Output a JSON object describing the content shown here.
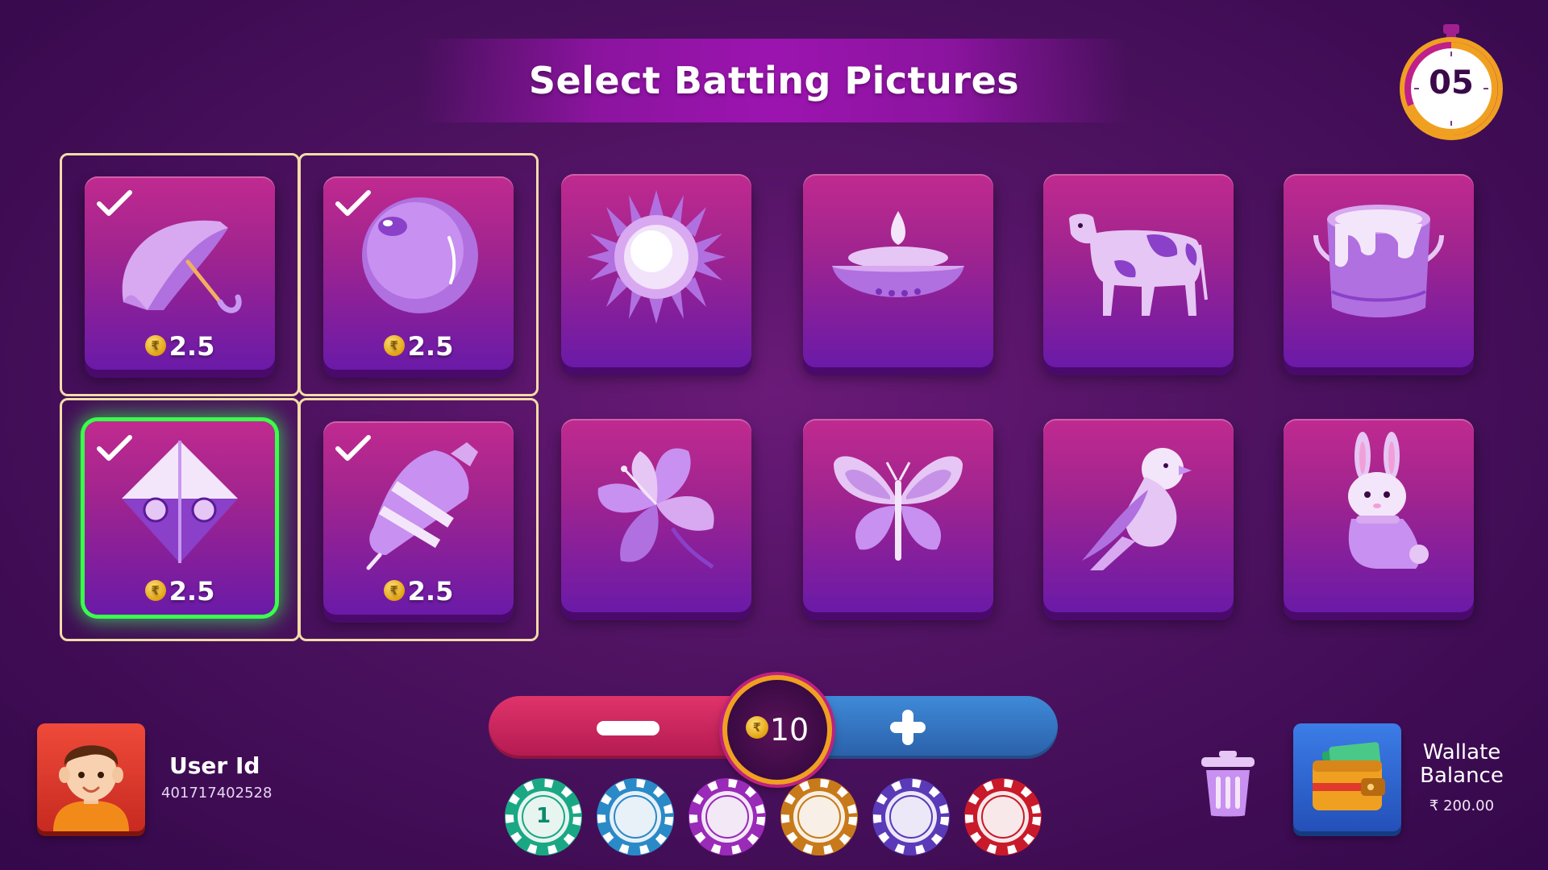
{
  "header": {
    "title": "Select Batting Pictures"
  },
  "timer": {
    "seconds": "05"
  },
  "tiles": [
    {
      "name": "umbrella",
      "selected": true,
      "amount": "2.5"
    },
    {
      "name": "ball",
      "selected": true,
      "amount": "2.5"
    },
    {
      "name": "sun",
      "selected": false,
      "amount": ""
    },
    {
      "name": "diya",
      "selected": false,
      "amount": ""
    },
    {
      "name": "cow",
      "selected": false,
      "amount": ""
    },
    {
      "name": "bucket",
      "selected": false,
      "amount": ""
    },
    {
      "name": "kite",
      "selected": true,
      "highlighted": true,
      "amount": "2.5"
    },
    {
      "name": "spinning-top",
      "selected": true,
      "amount": "2.5"
    },
    {
      "name": "flower",
      "selected": false,
      "amount": ""
    },
    {
      "name": "butterfly",
      "selected": false,
      "amount": ""
    },
    {
      "name": "bird",
      "selected": false,
      "amount": ""
    },
    {
      "name": "rabbit",
      "selected": false,
      "amount": ""
    }
  ],
  "currency_symbol": "₹",
  "stake": {
    "value": "10"
  },
  "chips": [
    {
      "label": "1",
      "color": "#1aa884"
    },
    {
      "label": "",
      "color": "#2a8ac8"
    },
    {
      "label": "",
      "color": "#9a2ab8"
    },
    {
      "label": "",
      "color": "#c87a1a"
    },
    {
      "label": "",
      "color": "#5a3ab8"
    },
    {
      "label": "",
      "color": "#c81a2a"
    }
  ],
  "user": {
    "label": "User Id",
    "id": "401717402528"
  },
  "wallet": {
    "label": "Wallate Balance",
    "balance": "₹ 200.00"
  },
  "colors": {
    "selected_border": "#f3dca8",
    "highlight": "#39ff4a",
    "timer_ring": "#f0a020"
  }
}
